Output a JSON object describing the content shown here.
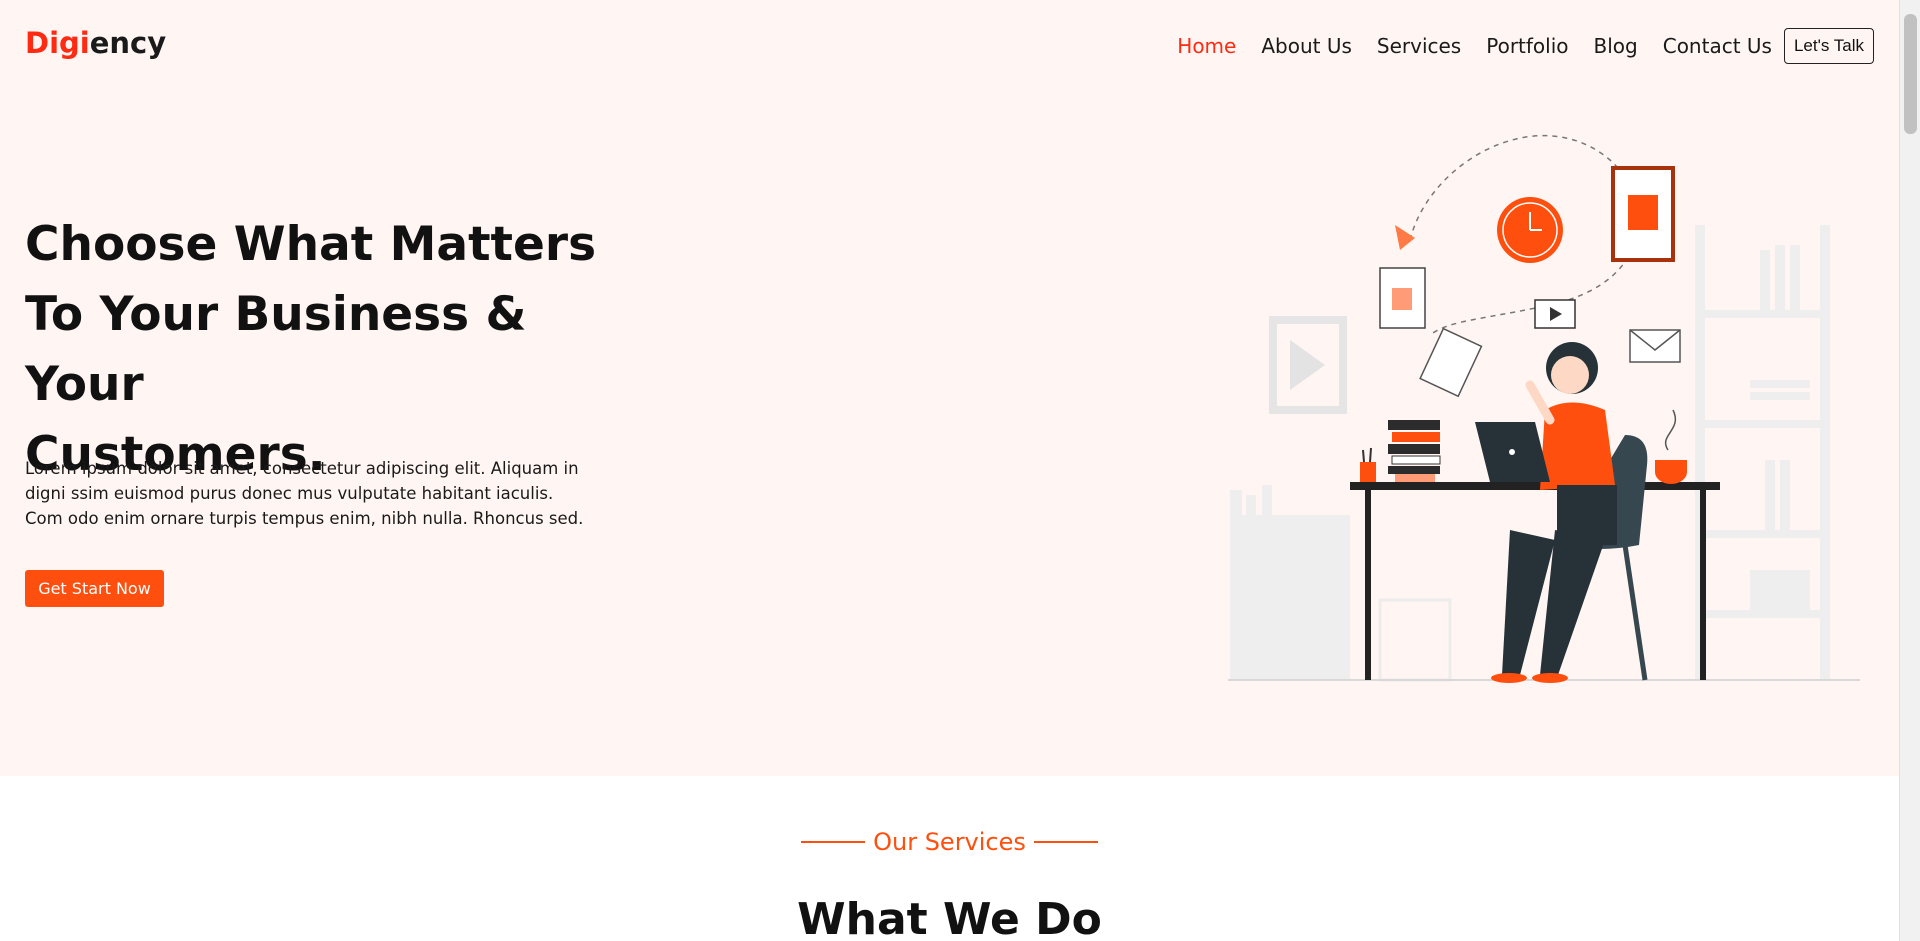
{
  "brand": {
    "part1": "Digi",
    "part2": "ency",
    "accent": "#ff2a12"
  },
  "nav": {
    "items": [
      "Home",
      "About Us",
      "Services",
      "Portfolio",
      "Blog",
      "Contact Us"
    ],
    "cta": "Let's Talk"
  },
  "hero": {
    "headline_line1": "Choose What Matters",
    "headline_line2": "To Your Business & Your",
    "headline_line3": "Customers.",
    "lead": "Lorem ipsum dolor sit amet, consectetur adipiscing elit. Aliquam in digni ssim euismod purus donec mus vulputate habitant iaculis. Com odo enim ornare turpis tempus enim, nibh nulla. Rhoncus sed.",
    "button": "Get Start Now",
    "background": "#fff5f2",
    "button_color": "#ff4f0f"
  },
  "services": {
    "eyebrow": "Our Services",
    "title": "What We Do"
  }
}
